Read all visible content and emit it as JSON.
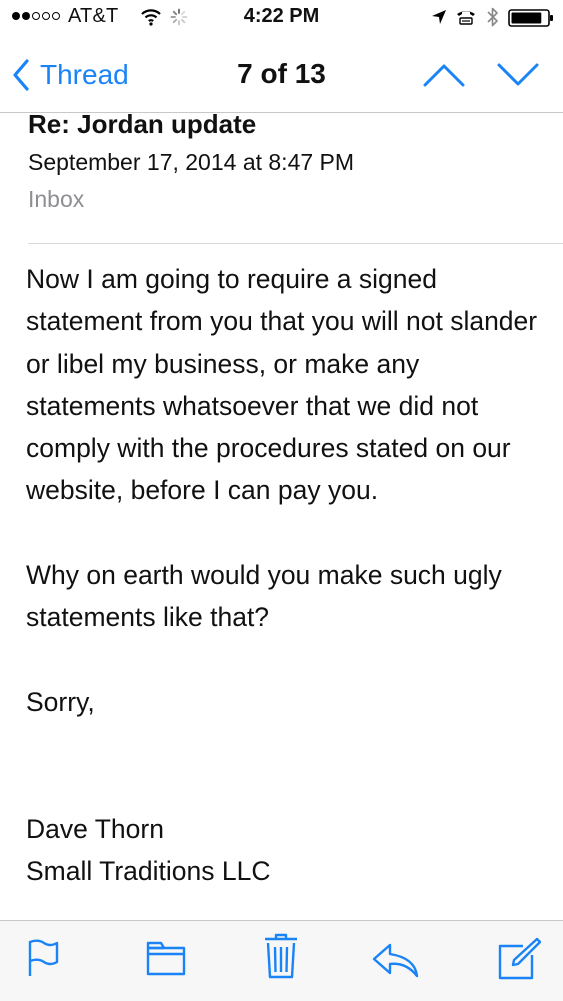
{
  "status_bar": {
    "carrier": "AT&T",
    "time": "4:22 PM",
    "signal_bars": 2,
    "signal_total": 5,
    "icons": [
      "wifi-icon",
      "activity-spinner-icon",
      "location-arrow-icon",
      "tty-icon",
      "bluetooth-icon",
      "battery-icon"
    ],
    "battery_level": 0.85
  },
  "nav": {
    "back_label": "Thread",
    "title": "7 of 13",
    "accent_color": "#1a84f6",
    "icons": [
      "chevron-left-icon",
      "chevron-up-icon",
      "chevron-down-icon"
    ]
  },
  "message": {
    "subject": "Re: Jordan update",
    "date": "September 17, 2014 at 8:47 PM",
    "mailbox": "Inbox",
    "paragraphs": [
      "Now I am going to require a signed statement from you that you will not slander or libel my business, or make any statements whatsoever that we did not comply with the procedures stated on our website, before I can pay you.",
      "Why on earth would you make such ugly statements like that?",
      "Sorry,"
    ],
    "signature": {
      "name": "Dave Thorn",
      "company": "Small Traditions LLC"
    }
  },
  "toolbar": {
    "icons": [
      "flag-icon",
      "folder-icon",
      "trash-icon",
      "reply-icon",
      "compose-icon"
    ]
  }
}
